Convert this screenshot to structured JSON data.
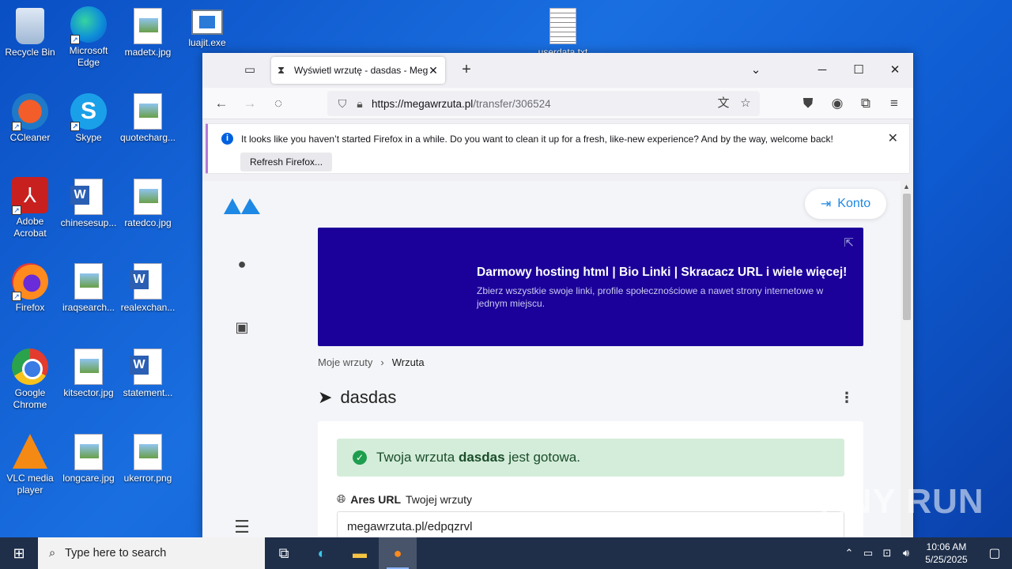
{
  "desktop": {
    "icons": [
      {
        "label": "Recycle Bin",
        "icon": "recycle-bin-icon"
      },
      {
        "label": "Microsoft Edge",
        "icon": "edge-icon"
      },
      {
        "label": "madetx.jpg",
        "icon": "image-file-icon"
      },
      {
        "label": "luajit.exe",
        "icon": "exe-file-icon"
      },
      {
        "label": "userdata.txt",
        "icon": "text-file-icon"
      },
      {
        "label": "CCleaner",
        "icon": "ccleaner-icon"
      },
      {
        "label": "Skype",
        "icon": "skype-icon"
      },
      {
        "label": "quotecharg...",
        "icon": "image-file-icon"
      },
      {
        "label": "Adobe Acrobat",
        "icon": "acrobat-icon"
      },
      {
        "label": "chinesesup...",
        "icon": "word-file-icon"
      },
      {
        "label": "ratedco.jpg",
        "icon": "image-file-icon"
      },
      {
        "label": "Firefox",
        "icon": "firefox-icon"
      },
      {
        "label": "iraqsearch...",
        "icon": "image-file-icon"
      },
      {
        "label": "realexchan...",
        "icon": "word-file-icon"
      },
      {
        "label": "Google Chrome",
        "icon": "chrome-icon"
      },
      {
        "label": "kitsector.jpg",
        "icon": "image-file-icon"
      },
      {
        "label": "statement...",
        "icon": "word-file-icon"
      },
      {
        "label": "VLC media player",
        "icon": "vlc-icon"
      },
      {
        "label": "longcare.jpg",
        "icon": "image-file-icon"
      },
      {
        "label": "ukerror.png",
        "icon": "image-file-icon"
      }
    ]
  },
  "browser": {
    "tab": {
      "title": "Wyświetl wrzutę - dasdas - Meg"
    },
    "url": {
      "host": "https://megawrzuta.pl",
      "path": "/transfer/306524"
    },
    "notification": {
      "message": "It looks like you haven’t started Firefox in a while. Do you want to clean it up for a fresh, like-new experience? And by the way, welcome back!",
      "button": "Refresh Firefox..."
    }
  },
  "page": {
    "account_button": "Konto",
    "banner": {
      "headline": "Darmowy hosting html | Bio Linki | Skracacz URL i wiele więcej!",
      "text": "Zbierz wszystkie swoje linki, profile społecznościowe a nawet strony internetowe w jednym miejscu."
    },
    "breadcrumb": {
      "parent": "Moje wrzuty",
      "current": "Wrzuta"
    },
    "title": "dasdas",
    "alert": {
      "prefix": "Twoja wrzuta",
      "name": "dasdas",
      "suffix": "jest gotowa."
    },
    "url_field": {
      "label_bold": "Ares URL",
      "label_rest": "Twojej wrzuty",
      "value": "megawrzuta.pl/edpqzrvl"
    }
  },
  "taskbar": {
    "search_placeholder": "Type here to search",
    "time": "10:06 AM",
    "date": "5/25/2025"
  },
  "watermark": "ANY RUN",
  "colors": {
    "accent": "#1e88e5",
    "banner": "#1b0099",
    "success_bg": "#d4edda",
    "taskbar": "#1f2f4a"
  }
}
